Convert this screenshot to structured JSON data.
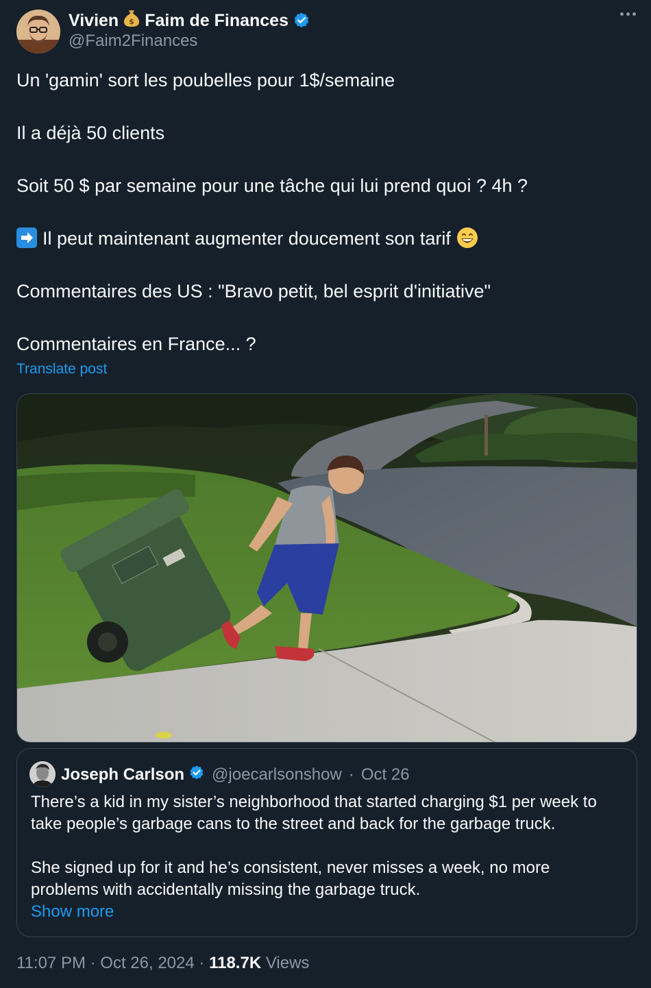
{
  "author": {
    "name_first": "Vivien",
    "name_emoji": "money-bag-icon",
    "name_last": "Faim de Finances",
    "handle": "@Faim2Finances",
    "verified": true
  },
  "post": {
    "lines": [
      "Un 'gamin' sort les poubelles pour 1$/semaine",
      "Il a déjà 50 clients",
      "Soit 50 $ par semaine pour une tâche qui lui prend quoi ? 4h ?",
      "Il peut maintenant augmenter doucement son tarif",
      "Commentaires des US : \"Bravo petit, bel esprit d'initiative\"",
      "Commentaires en France... ?"
    ],
    "translate_label": "Translate post"
  },
  "quote": {
    "name": "Joseph Carlson",
    "handle": "@joecarlsonshow",
    "date": "Oct 26",
    "verified": true,
    "paragraph1_line1": "There’s a kid in my sister’s neighborhood that started charging $1 per week to",
    "paragraph1_line2": "take people’s garbage cans to the street and back for the garbage truck.",
    "paragraph2_line1": "She signed up for it and he’s consistent, never misses a week, no more",
    "paragraph2_line2": "problems with accidentally missing the garbage truck.",
    "show_more": "Show more"
  },
  "footer": {
    "time": "11:07 PM",
    "date": "Oct 26, 2024",
    "views_count": "118.7K",
    "views_label": "Views"
  },
  "colors": {
    "background": "#15202b",
    "text": "#f7f9f9",
    "muted": "#8b98a5",
    "link": "#1d9bf0",
    "border": "#38444d"
  }
}
